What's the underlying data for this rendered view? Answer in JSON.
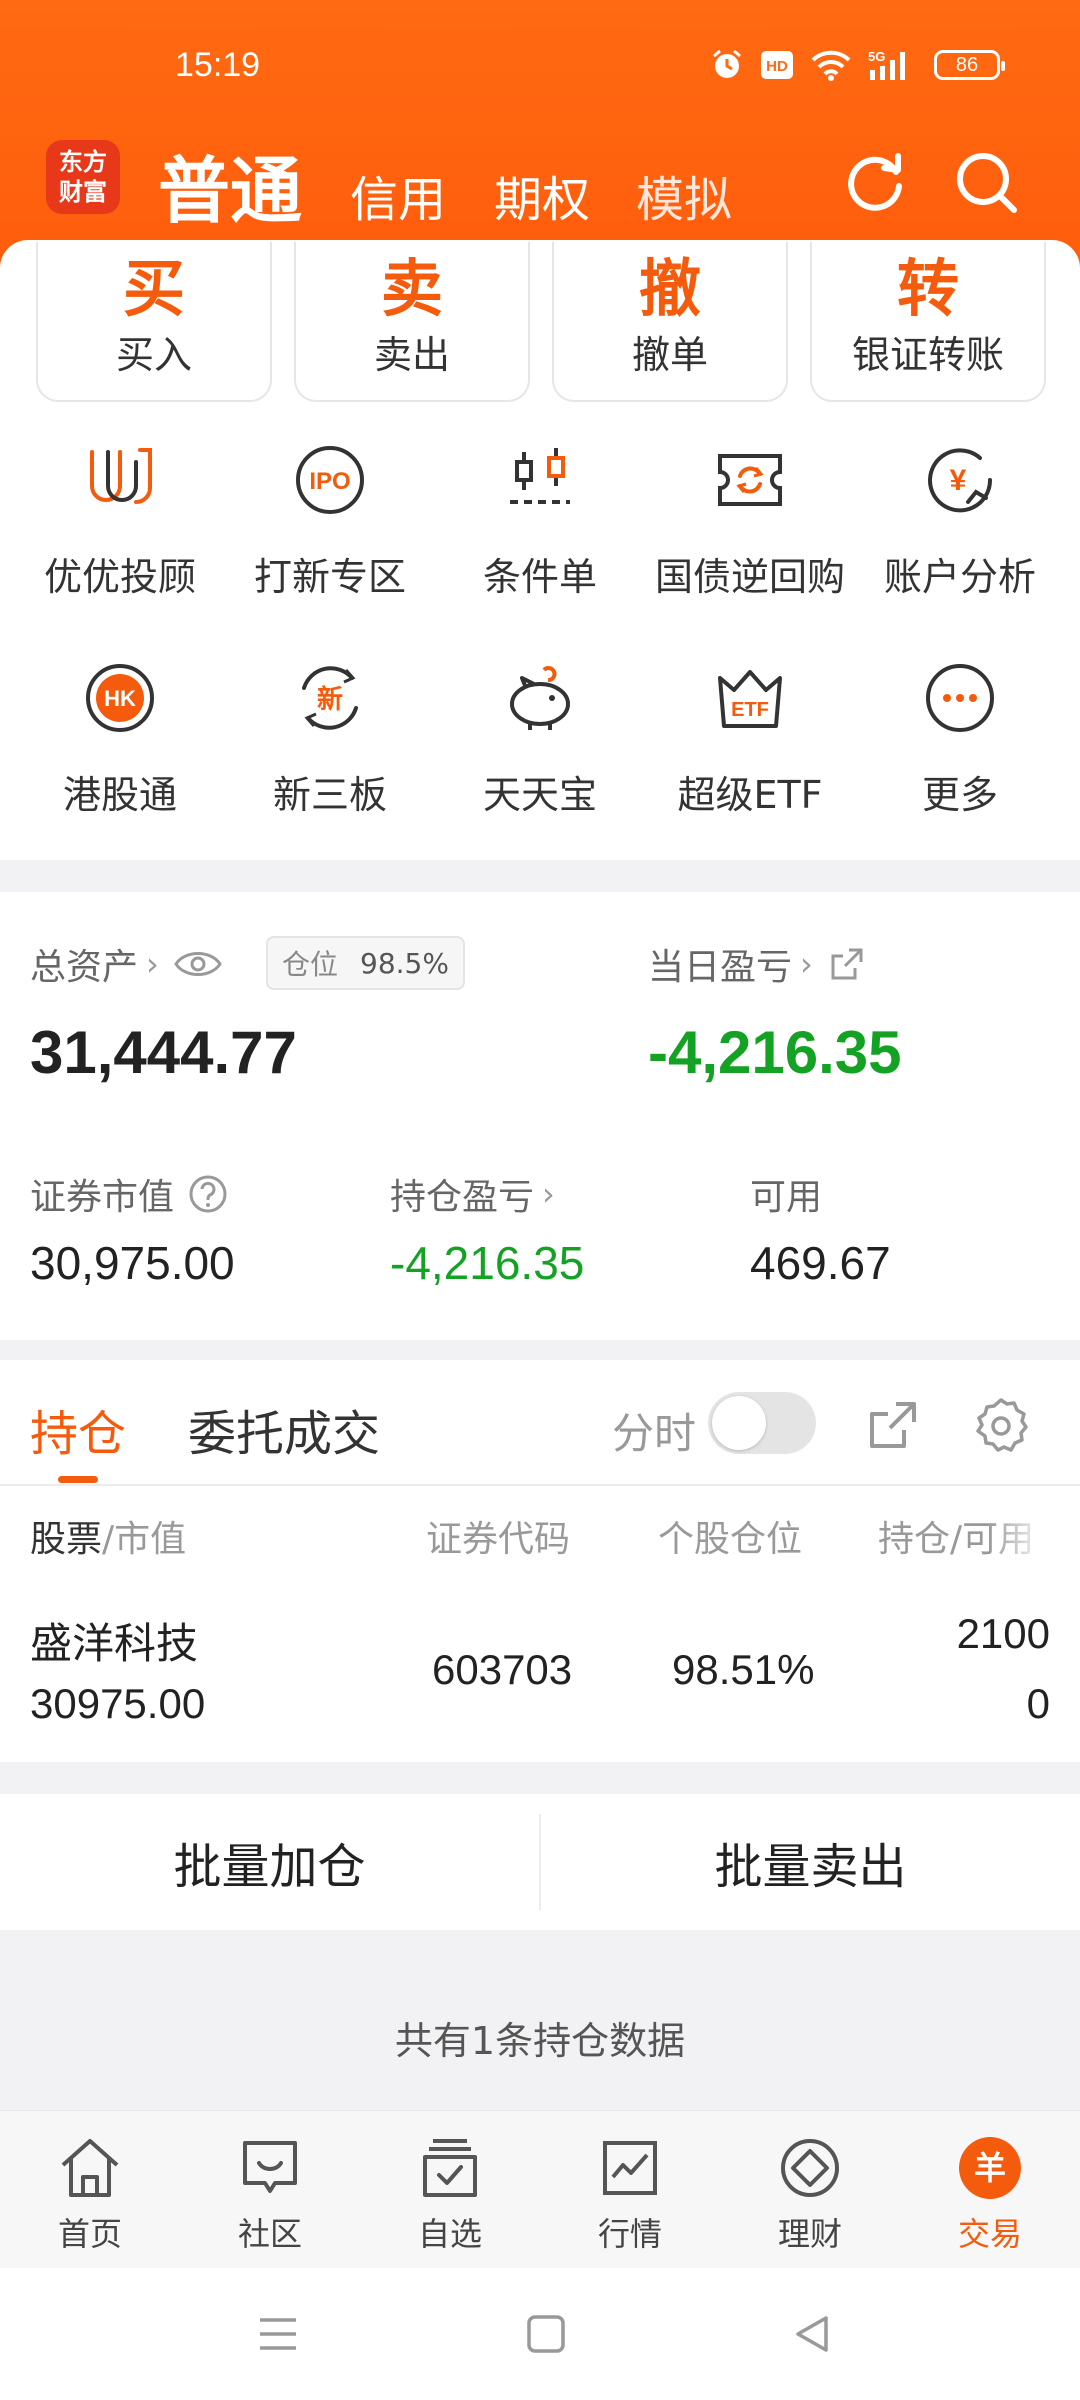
{
  "status_bar": {
    "time": "15:19",
    "network": "5G",
    "hd": "HD",
    "battery": "86"
  },
  "header": {
    "logo_text": [
      "东方",
      "财富"
    ],
    "tabs": [
      "普通",
      "信用",
      "期权",
      "模拟"
    ]
  },
  "quick_actions": [
    {
      "big": "买",
      "label": "买入"
    },
    {
      "big": "卖",
      "label": "卖出"
    },
    {
      "big": "撤",
      "label": "撤单"
    },
    {
      "big": "转",
      "label": "银证转账"
    }
  ],
  "grid_row1": [
    {
      "label": "优优投顾",
      "icon": "youyou-icon"
    },
    {
      "label": "打新专区",
      "icon": "ipo-icon",
      "icon_text": "IPO"
    },
    {
      "label": "条件单",
      "icon": "candlestick-icon"
    },
    {
      "label": "国债逆回购",
      "icon": "bond-repo-icon"
    },
    {
      "label": "账户分析",
      "icon": "yen-chart-icon",
      "icon_text": "¥"
    }
  ],
  "grid_row2": [
    {
      "label": "港股通",
      "icon": "hk-icon",
      "icon_text": "HK"
    },
    {
      "label": "新三板",
      "icon": "new-board-icon",
      "icon_text": "新"
    },
    {
      "label": "天天宝",
      "icon": "piggy-bank-icon"
    },
    {
      "label": "超级ETF",
      "icon": "etf-crown-icon",
      "icon_text": "ETF"
    },
    {
      "label": "更多",
      "icon": "more-icon"
    }
  ],
  "assets": {
    "total_label": "总资产",
    "position_label": "仓位",
    "position_value": "98.5%",
    "total_value": "31,444.77",
    "daily_pl_label": "当日盈亏",
    "daily_pl_value": "-4,216.35",
    "market_value_label": "证券市值",
    "market_value": "30,975.00",
    "holding_pl_label": "持仓盈亏",
    "holding_pl_value": "-4,216.35",
    "available_label": "可用",
    "available_value": "469.67"
  },
  "positions": {
    "tabs": [
      "持仓",
      "委托成交"
    ],
    "intraday_label": "分时",
    "columns": {
      "stock": "股票",
      "stock_sub": "/市值",
      "code": "证券代码",
      "weight": "个股仓位",
      "hold": "持仓/可用"
    },
    "rows": [
      {
        "name": "盛洋科技",
        "market_value": "30975.00",
        "code": "603703",
        "weight": "98.51%",
        "hold": "2100",
        "available": "0"
      }
    ]
  },
  "batch": {
    "add": "批量加仓",
    "sell": "批量卖出"
  },
  "summary": "共有1条持仓数据",
  "bottom_nav": [
    {
      "label": "首页",
      "icon": "home-icon"
    },
    {
      "label": "社区",
      "icon": "community-icon"
    },
    {
      "label": "自选",
      "icon": "watchlist-icon"
    },
    {
      "label": "行情",
      "icon": "market-icon"
    },
    {
      "label": "理财",
      "icon": "wealth-icon"
    },
    {
      "label": "交易",
      "icon": "trade-icon",
      "icon_text": "羊",
      "active": true
    }
  ],
  "colors": {
    "brand": "#f55b0c",
    "loss": "#13a223",
    "header_bg": "#ff5f0e"
  }
}
